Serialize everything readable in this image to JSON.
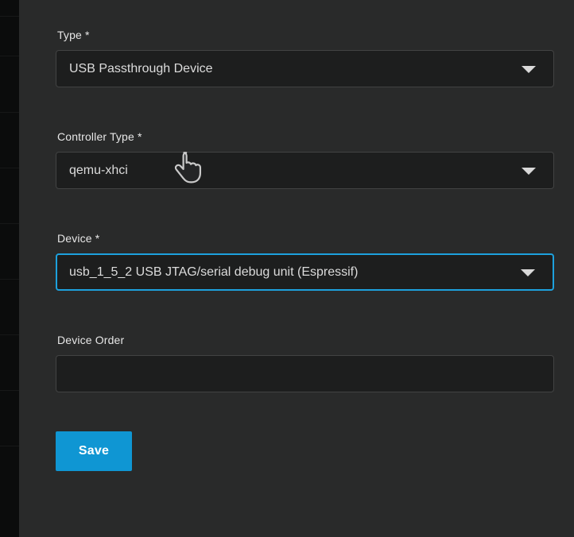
{
  "colors": {
    "accent_blue": "#0f96d3",
    "focus_border": "#1da1dd",
    "panel_bg": "#292a2a",
    "field_bg": "#1d1e1e"
  },
  "icons": {
    "dropdown_arrow": "filled-down-triangle",
    "hand_pointer": "pointing-hand-cursor"
  },
  "form": {
    "fields": [
      {
        "label": "Type *",
        "value": "USB Passthrough Device",
        "type": "select"
      },
      {
        "label": "Controller Type *",
        "value": "qemu-xhci",
        "type": "select"
      },
      {
        "label": "Device *",
        "value": "usb_1_5_2 USB JTAG/serial debug unit (Espressif)",
        "type": "select",
        "focused": true
      },
      {
        "label": "Device Order",
        "value": "",
        "placeholder": "",
        "type": "text"
      }
    ],
    "save_label": "Save"
  }
}
